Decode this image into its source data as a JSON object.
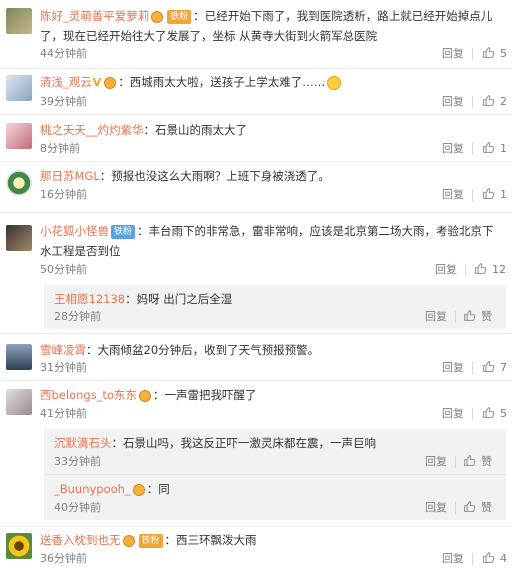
{
  "comments": [
    {
      "user": "陈好_灵萌善平爱萝莉",
      "badge": "铁粉",
      "text": "：已经开始下雨了，我到医院透析，路上就已经开始掉点儿了，现在已经开始往大了发展了，坐标 从黄寺大街到火箭军总医院",
      "time": "44分钟前",
      "reply": "回复",
      "likes": "5"
    },
    {
      "user": "清浅_观云",
      "text": "：西城雨太大啦，送孩子上学太难了……",
      "time": "39分钟前",
      "reply": "回复",
      "likes": "2"
    },
    {
      "user": "桃之夭夭__灼灼紫华",
      "text": "：石景山的雨太大了",
      "time": "8分钟前",
      "reply": "回复",
      "likes": "1"
    },
    {
      "user": "那日苏MGL",
      "text": "：预报也没这么大雨啊？上班下身被浇透了。",
      "time": "16分钟前",
      "reply": "回复",
      "likes": "1"
    },
    {
      "user": "小花狐小怪兽",
      "badge": "铁粉",
      "text": "：丰台雨下的非常急，雷非常响，应该是北京第二场大雨，考验北京下水工程是否到位",
      "time": "50分钟前",
      "reply": "回复",
      "likes": "12",
      "sub": {
        "user": "王相愿12138",
        "text": "：妈呀 出门之后全湿",
        "time": "28分钟前",
        "reply": "回复",
        "like_label": "赞"
      }
    },
    {
      "user": "雪峰凌霄",
      "text": "：大雨倾盆20分钟后，收到了天气预报预警。",
      "time": "31分钟前",
      "reply": "回复",
      "likes": "7"
    },
    {
      "user": "西belongs_to东东",
      "text": "：一声雷把我吓醒了",
      "time": "41分钟前",
      "reply": "回复",
      "likes": "5",
      "subs": [
        {
          "user": "沉默滴石头",
          "text": "：石景山吗，我这反正吓一激灵床都在震，一声巨响",
          "time": "33分钟前",
          "reply": "回复",
          "like_label": "赞"
        },
        {
          "user": "_Buunypooh_",
          "text": "：同",
          "time": "40分钟前",
          "reply": "回复",
          "like_label": "赞"
        }
      ]
    },
    {
      "user": "送香入枕到也无",
      "badge": "铁粉",
      "text": "：西三环飘泼大雨",
      "time": "36分钟前",
      "reply": "回复",
      "likes": "4"
    }
  ],
  "colors": {
    "username": "#eb7350",
    "meta": "#808080",
    "subBg": "#f2f2f2",
    "badgeGold": "#f2a33a",
    "badgeBlue": "#5aa4e0"
  },
  "icons": {
    "like": "thumbs-up-icon",
    "verified": "v-mark-icon",
    "medal": "medal-icon",
    "emoji": "smiley-emoji-icon"
  }
}
